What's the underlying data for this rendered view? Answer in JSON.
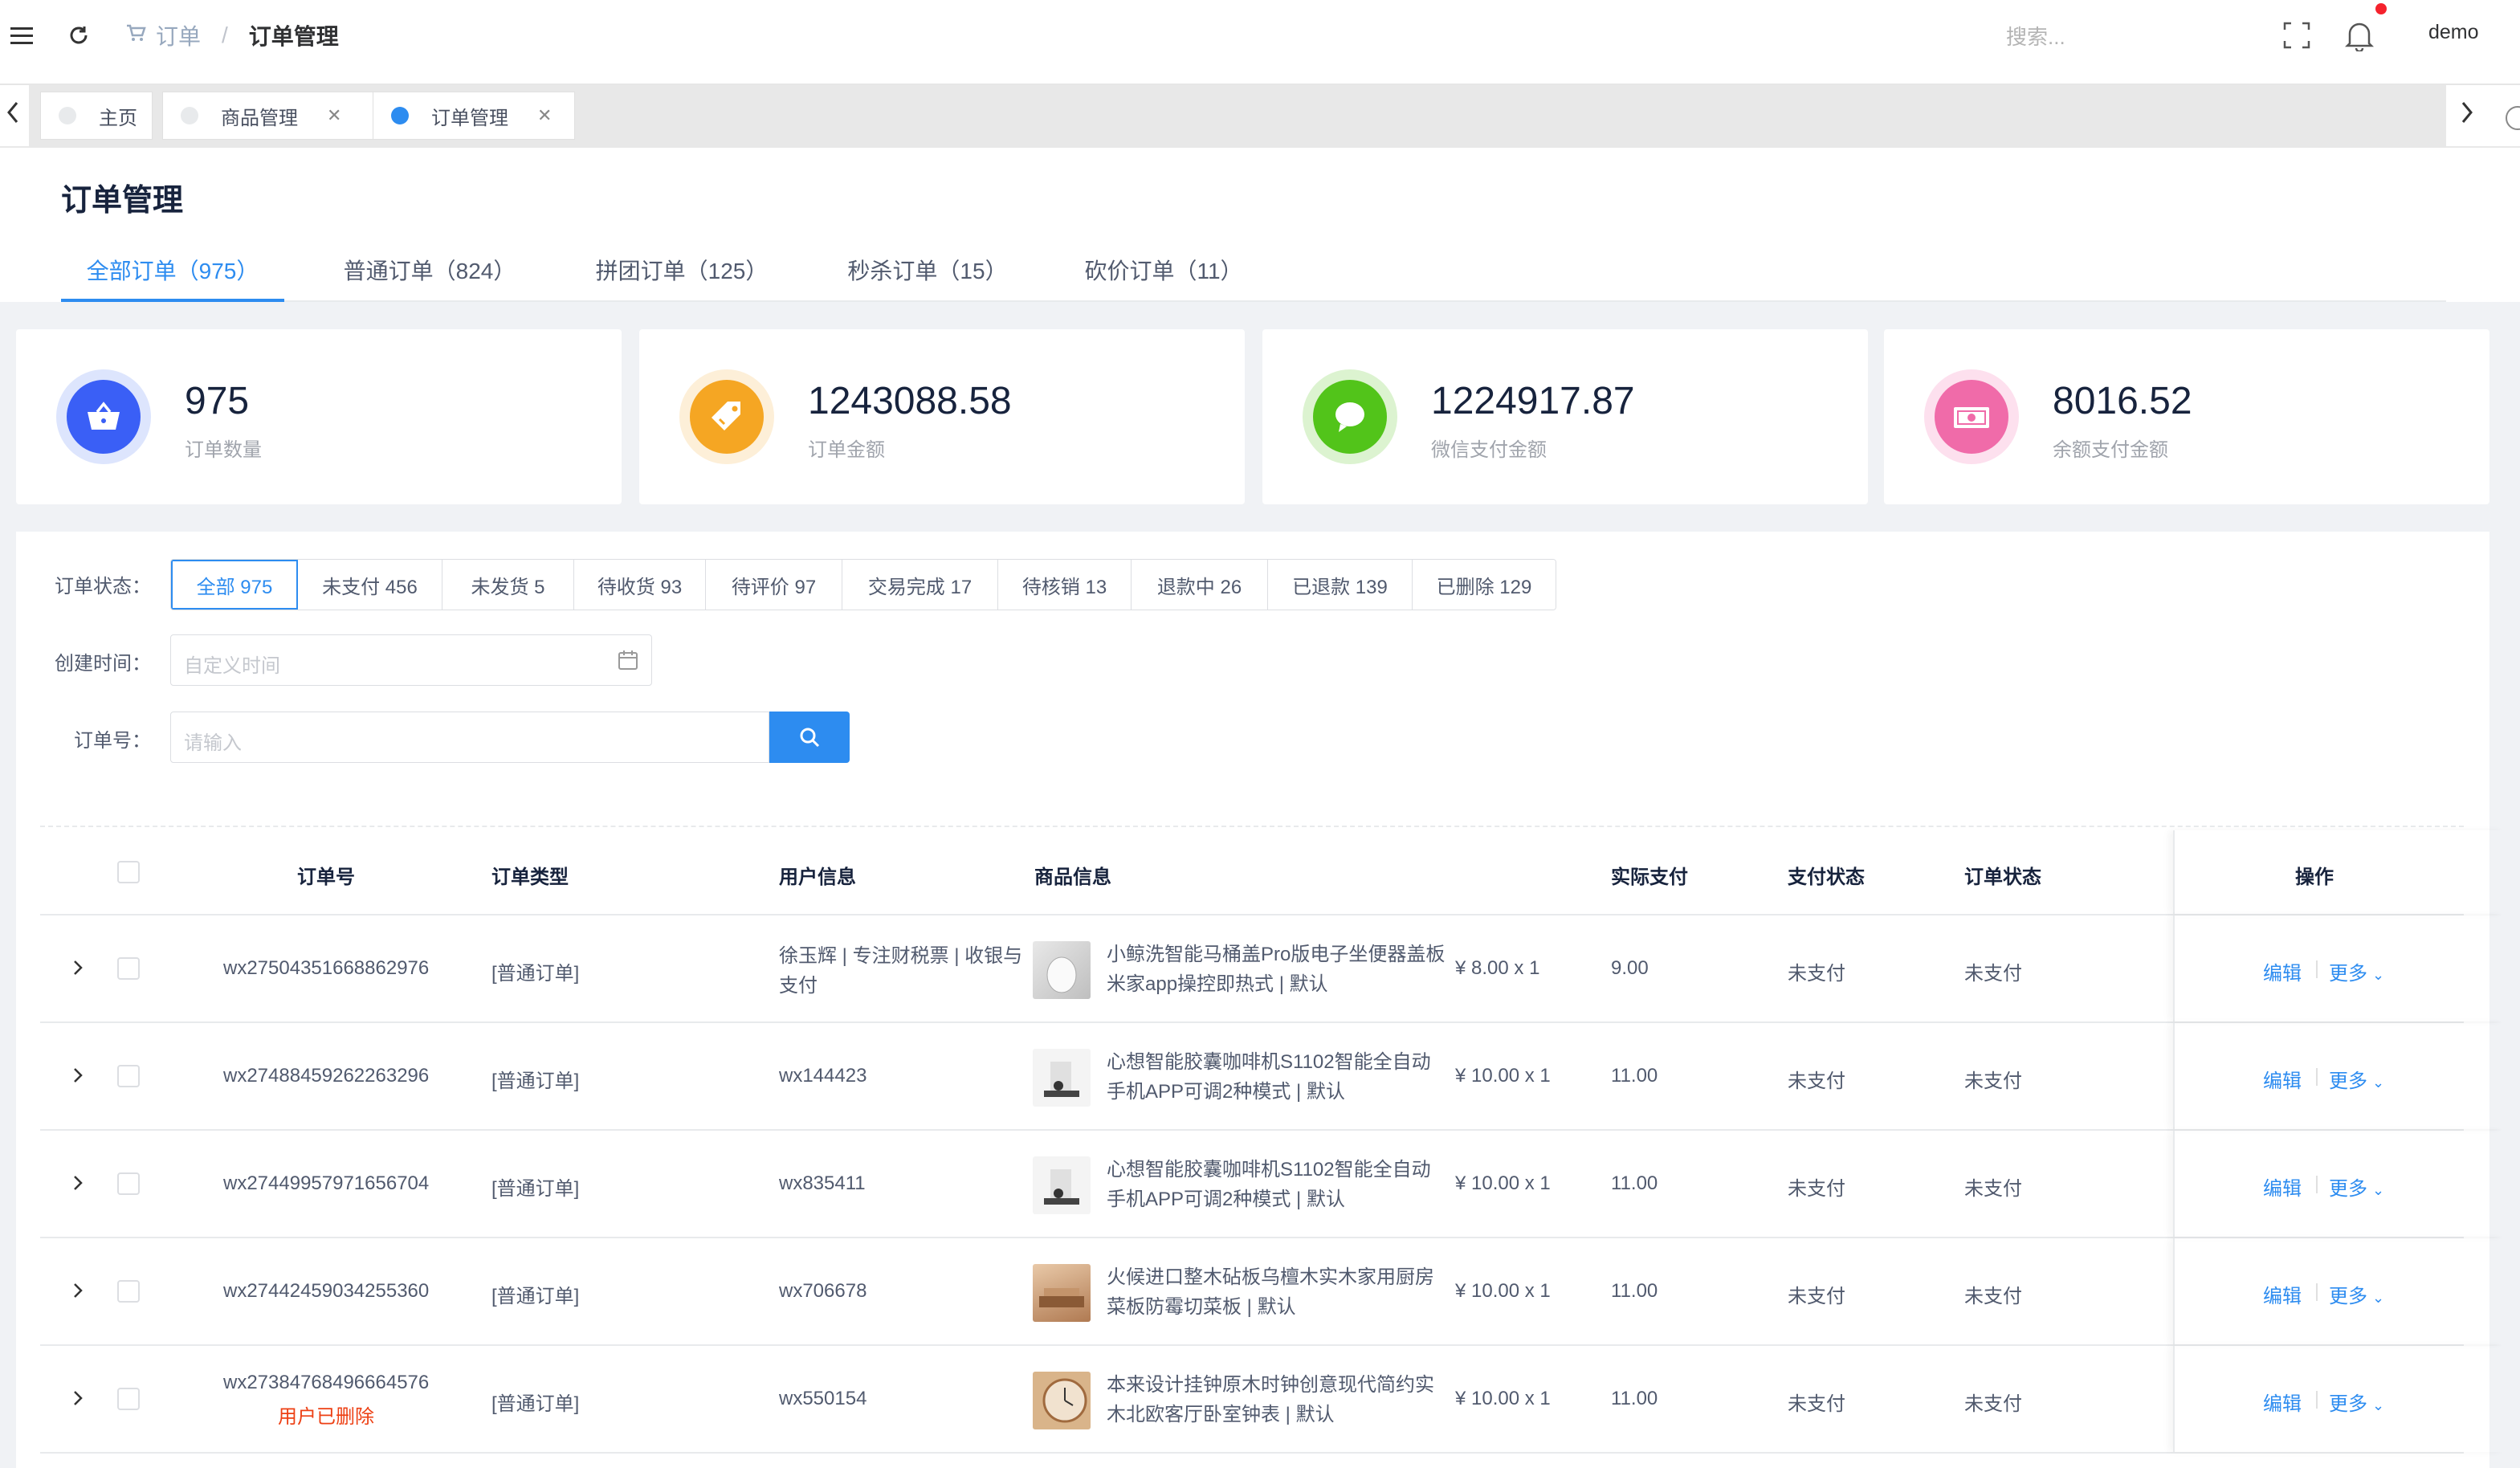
{
  "header": {
    "breadcrumb": [
      "订单",
      "订单管理"
    ],
    "search_placeholder": "搜索...",
    "user": "demo"
  },
  "tags": [
    {
      "label": "主页"
    },
    {
      "label": "商品管理"
    },
    {
      "label": "订单管理"
    }
  ],
  "page": {
    "title": "订单管理",
    "tabs": [
      "全部订单（975）",
      "普通订单（824）",
      "拼团订单（125）",
      "秒杀订单（15）",
      "砍价订单（11）"
    ]
  },
  "stats": [
    {
      "value": "975",
      "label": "订单数量",
      "color": "#3a5ff6",
      "icon": "basket-icon"
    },
    {
      "value": "1243088.58",
      "label": "订单金额",
      "color": "#f5a623",
      "icon": "price-tag-icon"
    },
    {
      "value": "1224917.87",
      "label": "微信支付金额",
      "color": "#52c41a",
      "icon": "wechat-chat-icon"
    },
    {
      "value": "8016.52",
      "label": "余额支付金额",
      "color": "#f06ba9",
      "icon": "money-icon"
    }
  ],
  "filters": {
    "status_label": "订单状态：",
    "status_options": [
      "全部 975",
      "未支付 456",
      "未发货 5",
      "待收货 93",
      "待评价 97",
      "交易完成 17",
      "待核销 13",
      "退款中 26",
      "已退款 139",
      "已删除 129"
    ],
    "date_label": "创建时间：",
    "date_placeholder": "自定义时间",
    "order_label": "订单号：",
    "order_placeholder": "请输入"
  },
  "table": {
    "headers": [
      "订单号",
      "订单类型",
      "用户信息",
      "商品信息",
      "实际支付",
      "支付状态",
      "订单状态",
      "操作"
    ],
    "edit_label": "编辑",
    "more_label": "更多",
    "rows": [
      {
        "order_no": "wx27504351668862976",
        "note": "",
        "type": "[普通订单]",
        "user": "徐玉辉 | 专注财税票 | 收银与支付",
        "goods": "小鲸洗智能马桶盖Pro版电子坐便器盖板米家app操控即热式 | 默认",
        "price": "¥ 8.00 x 1",
        "paid": "9.00",
        "pay_status": "未支付",
        "order_status": "未支付"
      },
      {
        "order_no": "wx27488459262263296",
        "note": "",
        "type": "[普通订单]",
        "user": "wx144423",
        "goods": "心想智能胶囊咖啡机S1102智能全自动手机APP可调2种模式 | 默认",
        "price": "¥ 10.00 x 1",
        "paid": "11.00",
        "pay_status": "未支付",
        "order_status": "未支付"
      },
      {
        "order_no": "wx27449957971656704",
        "note": "",
        "type": "[普通订单]",
        "user": "wx835411",
        "goods": "心想智能胶囊咖啡机S1102智能全自动手机APP可调2种模式 | 默认",
        "price": "¥ 10.00 x 1",
        "paid": "11.00",
        "pay_status": "未支付",
        "order_status": "未支付"
      },
      {
        "order_no": "wx27442459034255360",
        "note": "",
        "type": "[普通订单]",
        "user": "wx706678",
        "goods": "火候进口整木砧板乌檀木实木家用厨房菜板防霉切菜板 | 默认",
        "price": "¥ 10.00 x 1",
        "paid": "11.00",
        "pay_status": "未支付",
        "order_status": "未支付"
      },
      {
        "order_no": "wx27384768496664576",
        "note": "用户已删除",
        "type": "[普通订单]",
        "user": "wx550154",
        "goods": "本来设计挂钟原木时钟创意现代简约实木北欧客厅卧室钟表 | 默认",
        "price": "¥ 10.00 x 1",
        "paid": "11.00",
        "pay_status": "未支付",
        "order_status": "未支付"
      }
    ]
  }
}
